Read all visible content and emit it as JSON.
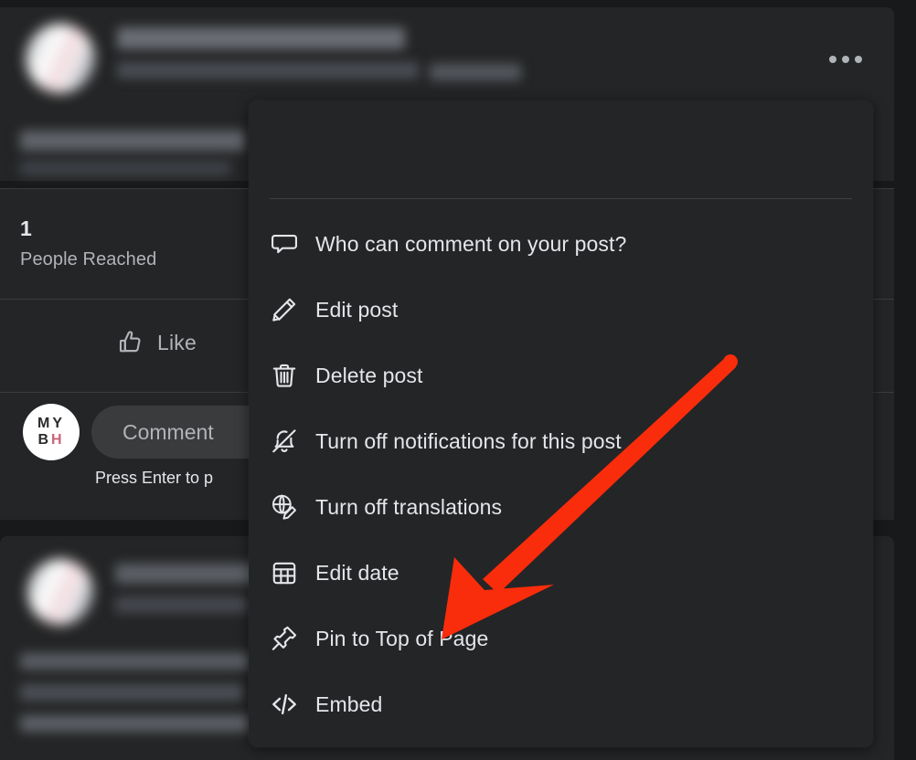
{
  "app": {
    "background_color": "#18191a",
    "surface_color": "#242526",
    "divider_color": "#3a3b3c",
    "text_primary": "#e4e6eb",
    "text_secondary": "#b0b3b8",
    "annotation_color": "#f92c0c"
  },
  "post": {
    "more_options_button": "•••",
    "content_masked": true
  },
  "insights": {
    "reach_count": "1",
    "reach_label": "People Reached"
  },
  "actions": {
    "like_label": "Like",
    "like_icon": "thumbs-up-icon"
  },
  "comment": {
    "avatar_initials_top": "MY",
    "avatar_initials_bottom_left": "B",
    "avatar_initials_bottom_right": "H",
    "placeholder": "Comment",
    "hint": "Press Enter to p"
  },
  "menu": {
    "items": [
      {
        "label": "Who can comment on your post?",
        "icon": "comment-bubble-icon"
      },
      {
        "label": "Edit post",
        "icon": "pencil-icon"
      },
      {
        "label": "Delete post",
        "icon": "trash-icon"
      },
      {
        "label": "Turn off notifications for this post",
        "icon": "bell-slash-icon"
      },
      {
        "label": "Turn off translations",
        "icon": "globe-pencil-icon"
      },
      {
        "label": "Edit date",
        "icon": "calendar-icon"
      },
      {
        "label": "Pin to Top of Page",
        "icon": "pin-icon"
      },
      {
        "label": "Embed",
        "icon": "code-brackets-icon"
      }
    ]
  },
  "annotation": {
    "type": "arrow",
    "color": "#f92c0c",
    "points_to": "Pin to Top of Page"
  }
}
